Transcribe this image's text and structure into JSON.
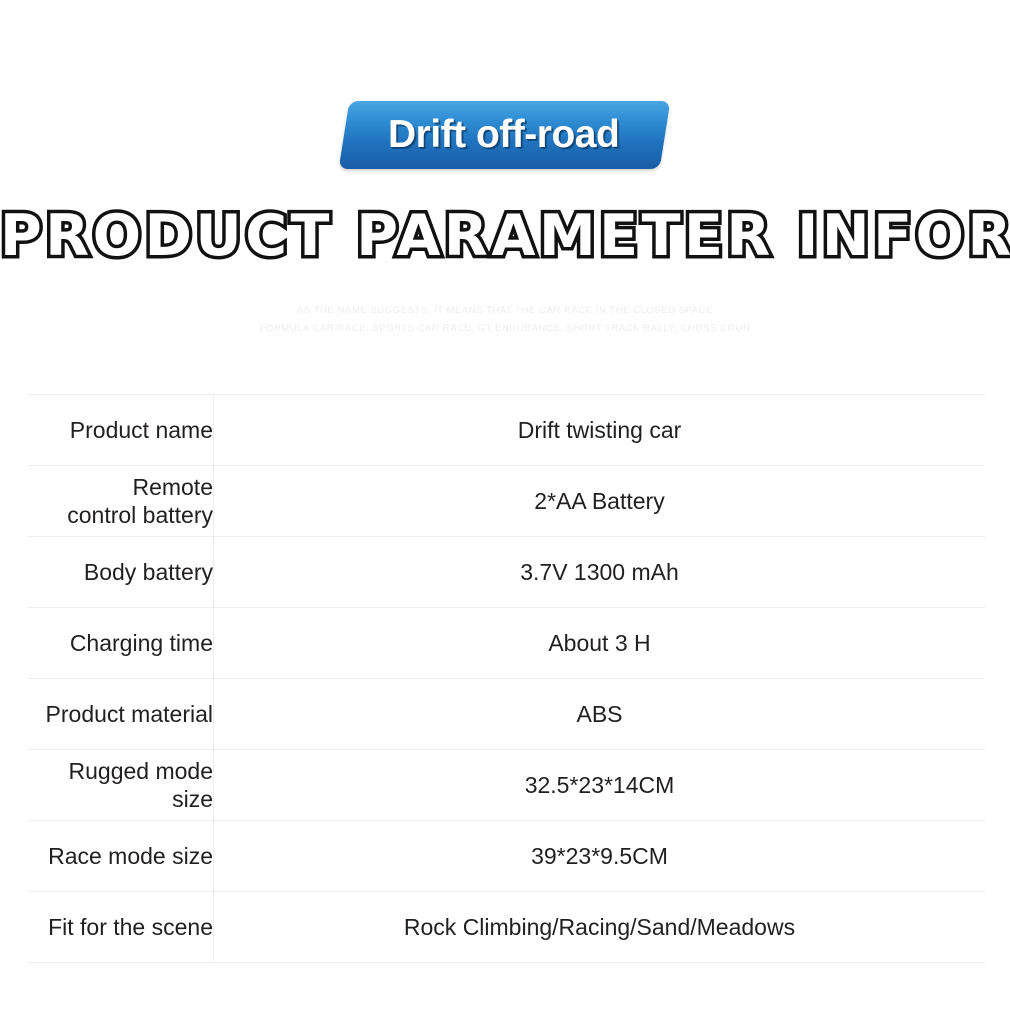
{
  "banner": {
    "label": "Drift off-road",
    "gradient_top": "#4aa6e3",
    "gradient_bottom": "#1a5ca6"
  },
  "heading": {
    "title": "PRODUCT PARAMETER INFORMATION"
  },
  "description": {
    "line1": "AS THE NAME SUGGESTS, IT MEANS THAT THE CAR RACE IN THE CLOSED SPACE",
    "line2": "FORMULA CAR RACE, SPORTS CAR RACE, GT ENDURANCE, SHORT TRACK RALLY, CROSS COUN"
  },
  "spec_table": {
    "rows": [
      {
        "label": "Product name",
        "value": "Drift twisting car"
      },
      {
        "label": "Remote\ncontrol battery",
        "label_line1": "Remote",
        "label_line2": "control battery",
        "value": "2*AA Battery"
      },
      {
        "label": "Body battery",
        "value": "3.7V 1300 mAh"
      },
      {
        "label": "Charging time",
        "value": "About 3 H"
      },
      {
        "label": "Product material",
        "value": "ABS"
      },
      {
        "label": "Rugged mode size",
        "value": "32.5*23*14CM"
      },
      {
        "label": "Race mode size",
        "value": "39*23*9.5CM"
      },
      {
        "label": "Fit for the scene",
        "value": "Rock Climbing/Racing/Sand/Meadows"
      }
    ]
  }
}
